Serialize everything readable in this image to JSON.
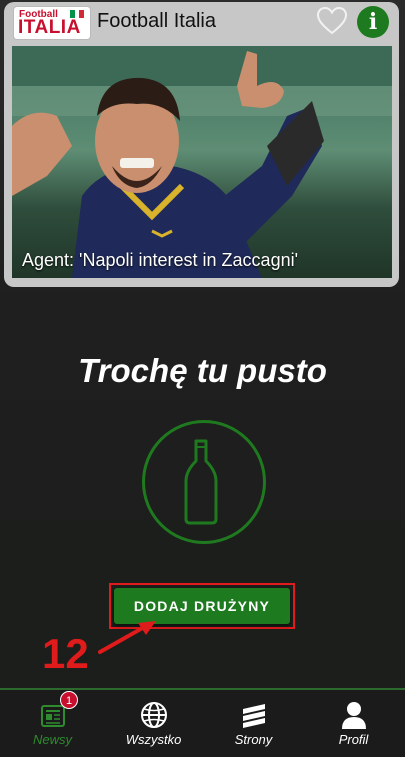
{
  "news_card": {
    "logo": {
      "line1": "Football",
      "line2": "ITALIA"
    },
    "source_name": "Football Italia",
    "caption": "Agent: 'Napoli interest in Zaccagni'"
  },
  "empty_state": {
    "title": "Trochę tu pusto",
    "button_label": "DODAJ DRUŻYNY"
  },
  "annotation": {
    "step_number": "12"
  },
  "tabbar": {
    "items": [
      {
        "label": "Newsy",
        "icon": "newspaper-icon",
        "active": true,
        "badge": "1"
      },
      {
        "label": "Wszystko",
        "icon": "globe-icon",
        "active": false
      },
      {
        "label": "Strony",
        "icon": "stack-icon",
        "active": false
      },
      {
        "label": "Profil",
        "icon": "user-icon",
        "active": false
      }
    ]
  },
  "colors": {
    "accent": "#1e7a1e",
    "highlight": "#e01b1b",
    "badge": "#c8102e"
  }
}
